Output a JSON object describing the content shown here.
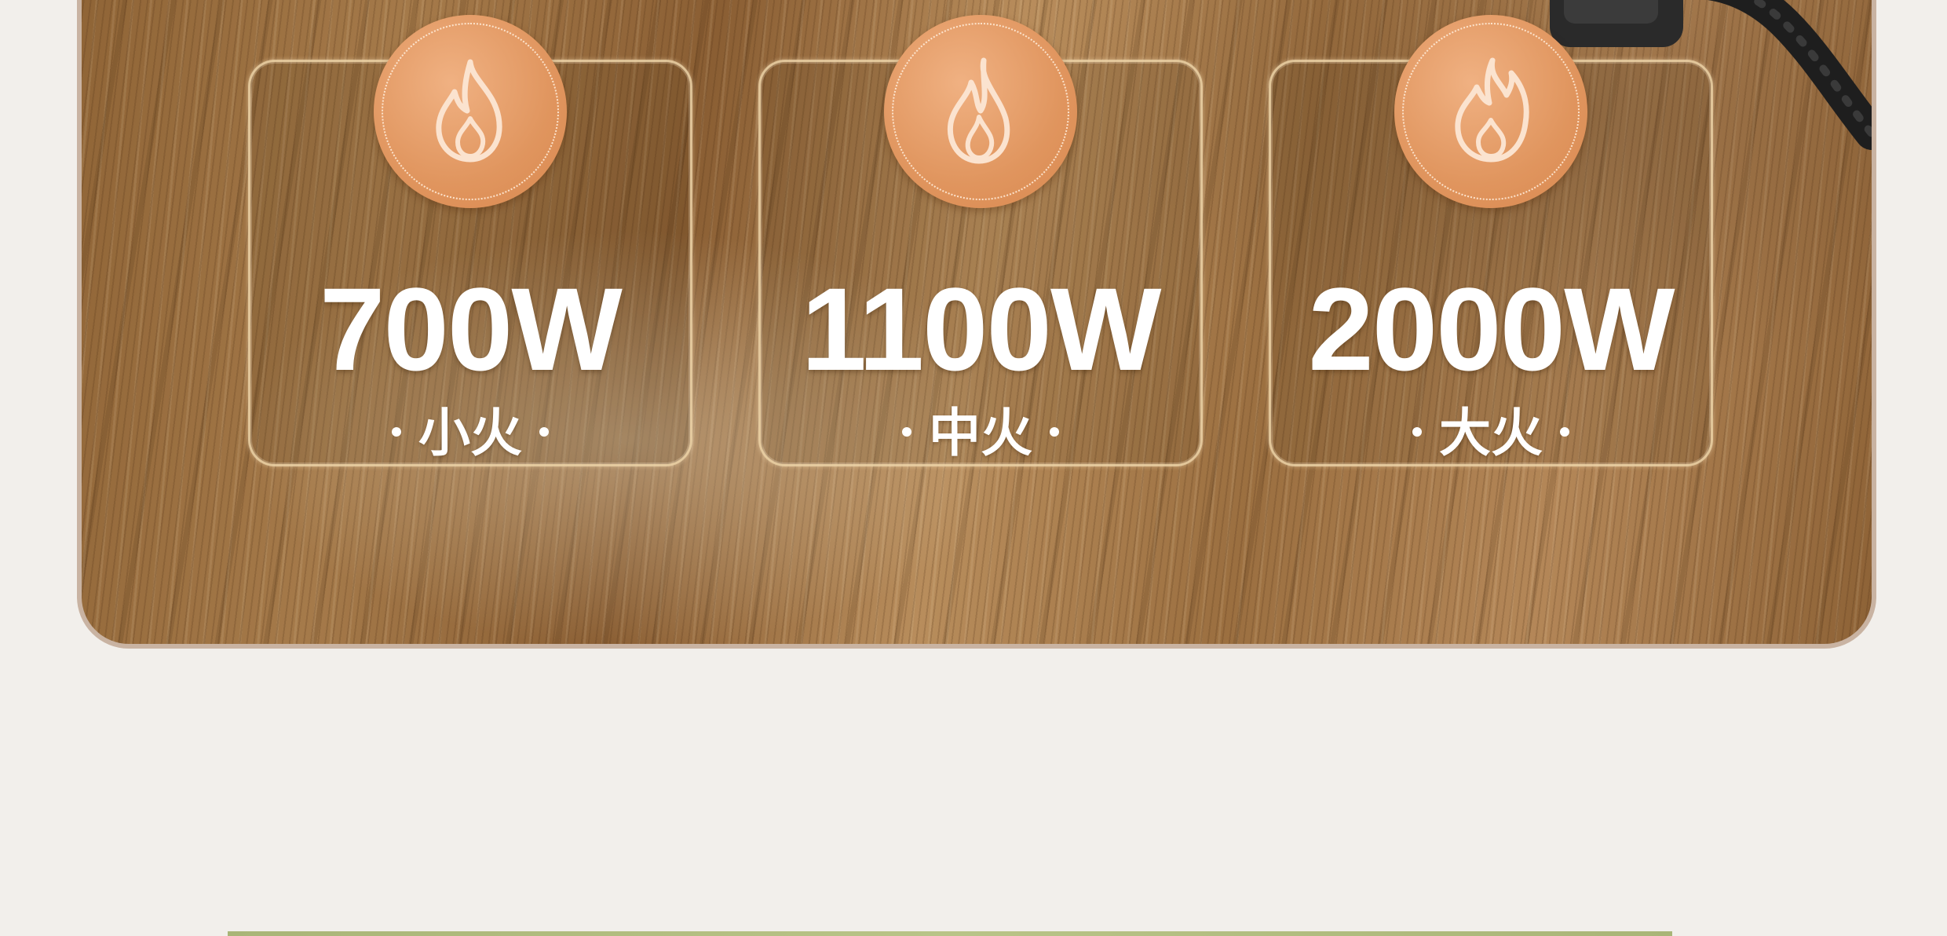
{
  "colors": {
    "page_background": "#f2efeb",
    "panel_border": "#c9b3a2",
    "badge_orange": "#e0955e",
    "text": "#ffffff"
  },
  "power_levels": [
    {
      "power": "700W",
      "level": "小火",
      "icon": "flame-icon"
    },
    {
      "power": "1100W",
      "level": "中火",
      "icon": "flame-icon"
    },
    {
      "power": "2000W",
      "level": "大火",
      "icon": "flame-icon"
    }
  ]
}
